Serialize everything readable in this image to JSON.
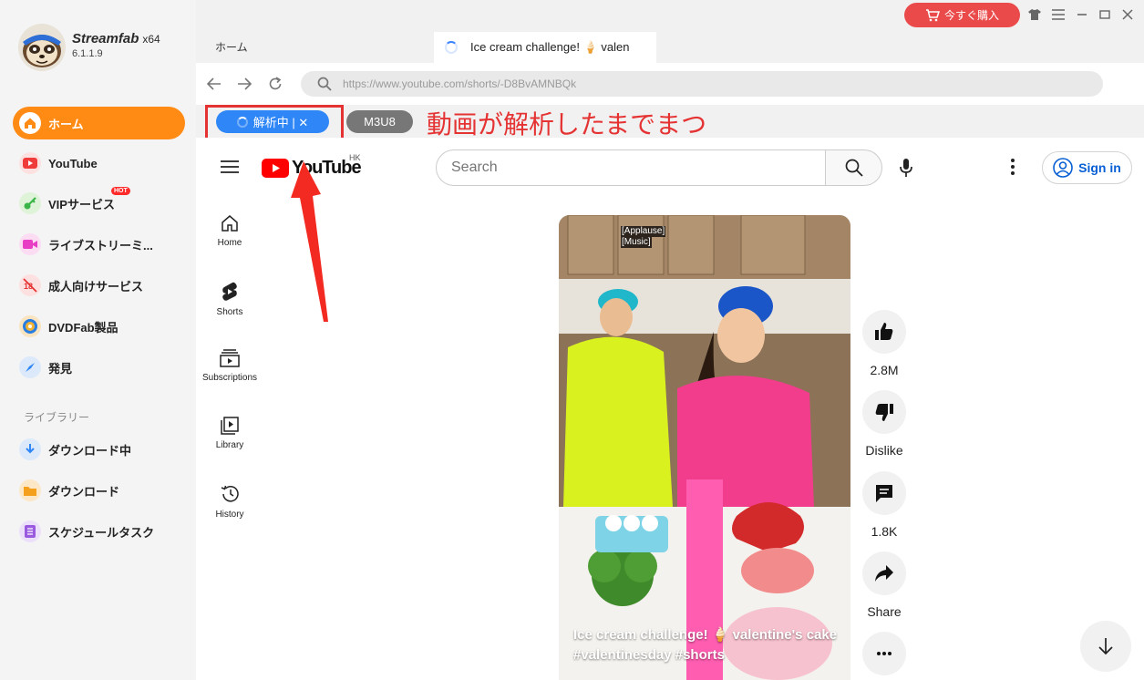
{
  "app": {
    "name": "Streamfab",
    "arch": "x64",
    "version": "6.1.1.9"
  },
  "sidebar": {
    "items": [
      {
        "label": "ホーム",
        "icon": "home-icon"
      },
      {
        "label": "YouTube",
        "icon": "youtube-icon"
      },
      {
        "label": "VIPサービス",
        "icon": "key-icon",
        "badge": "HOT"
      },
      {
        "label": "ライブストリーミ...",
        "icon": "live-camera-icon"
      },
      {
        "label": "成人向けサービス",
        "icon": "adult-block-icon"
      },
      {
        "label": "DVDFab製品",
        "icon": "dvdfab-icon"
      },
      {
        "label": "発見",
        "icon": "compass-icon"
      }
    ],
    "library_header": "ライブラリー",
    "library_items": [
      {
        "label": "ダウンロード中",
        "icon": "download-arrow-icon"
      },
      {
        "label": "ダウンロード",
        "icon": "folder-icon"
      },
      {
        "label": "スケジュールタスク",
        "icon": "schedule-list-icon"
      }
    ]
  },
  "titlebar": {
    "buy_label": "今すぐ購入",
    "tabs": {
      "home": "ホーム",
      "video": "Ice cream challenge! 🍦 valentine's cake"
    }
  },
  "browser": {
    "url": "https://www.youtube.com/shorts/-D8BvAMNBQk"
  },
  "analysis": {
    "analyzing_label": "解析中 | ✕",
    "m3u8_label": "M3U8",
    "annotation": "動画が解析したまでまつ"
  },
  "youtube": {
    "logo_text": "YouTube",
    "region": "HK",
    "search_placeholder": "Search",
    "sign_in": "Sign in",
    "side_nav": [
      "Home",
      "Shorts",
      "Subscriptions",
      "Library",
      "History"
    ],
    "captions": [
      "[Applause]",
      "[Music]"
    ],
    "video_caption_line1": "Ice cream challenge! 🍦 valentine's cake",
    "video_caption_line2": "#valentinesday #shorts",
    "likes": "2.8M",
    "dislike_label": "Dislike",
    "comments": "1.8K",
    "share_label": "Share"
  },
  "colors": {
    "accent": "#ff8a14",
    "buy": "#ea4a4a",
    "analyzing": "#2f86f6",
    "annotation": "#e53232",
    "youtube_red": "#ff0000"
  }
}
